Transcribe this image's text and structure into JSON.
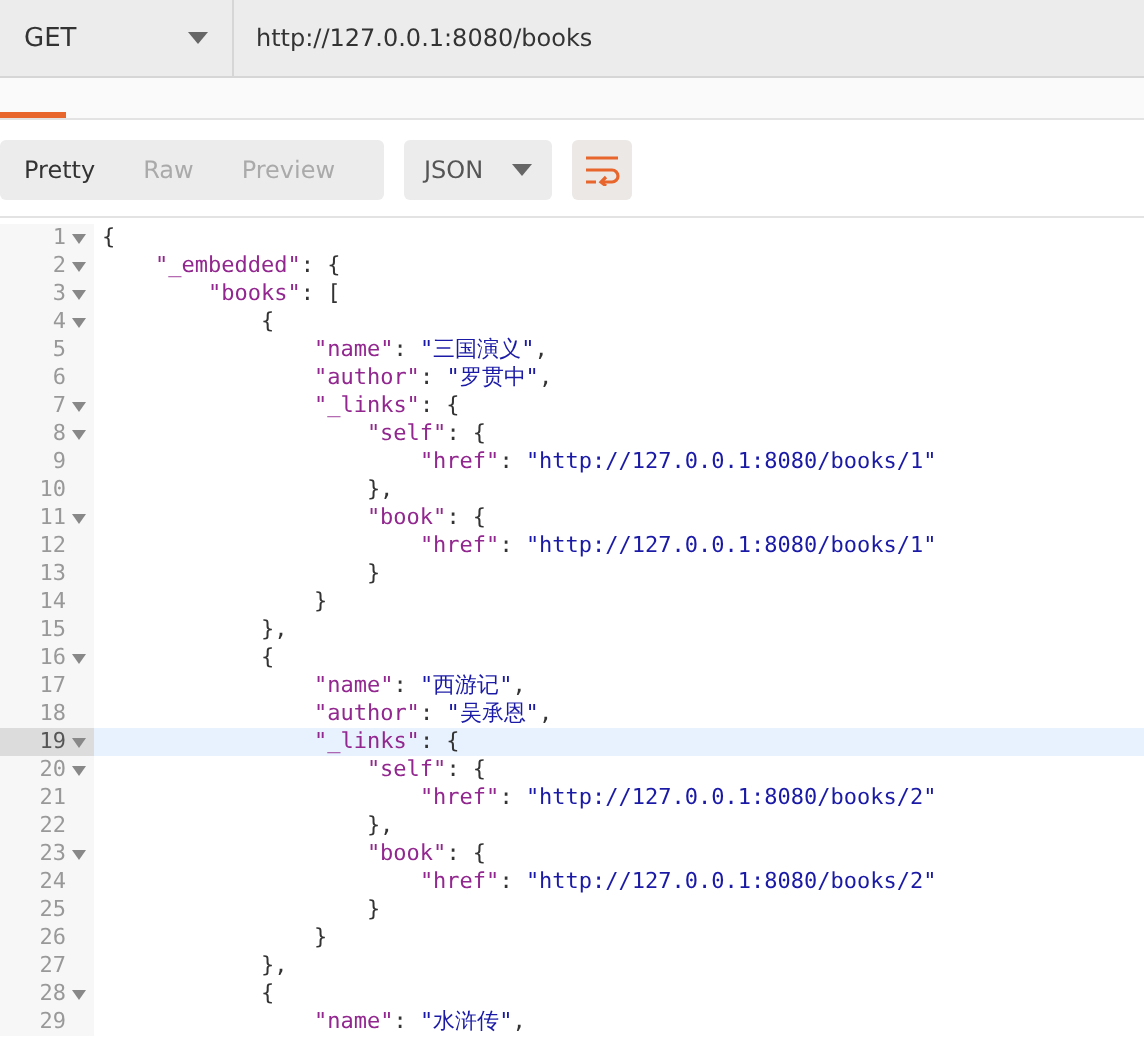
{
  "request": {
    "method": "GET",
    "url": "http://127.0.0.1:8080/books"
  },
  "view_tabs": [
    {
      "label": "Pretty",
      "selected": true
    },
    {
      "label": "Raw",
      "selected": false
    },
    {
      "label": "Preview",
      "selected": false
    }
  ],
  "format": "JSON",
  "wrap_lines": {
    "on": true
  },
  "editor": {
    "lines": [
      {
        "number": "1",
        "fold": true,
        "active": false,
        "parts": [
          {
            "kind": "punct",
            "text": "{"
          }
        ]
      },
      {
        "number": "2",
        "fold": true,
        "active": false,
        "parts": [
          {
            "kind": "key",
            "text": "\"_embedded\""
          },
          {
            "kind": "punct",
            "text": ": {"
          }
        ]
      },
      {
        "number": "3",
        "fold": true,
        "active": false,
        "parts": [
          {
            "kind": "key",
            "text": "\"books\""
          },
          {
            "kind": "punct",
            "text": ": ["
          }
        ]
      },
      {
        "number": "4",
        "fold": true,
        "active": false,
        "parts": [
          {
            "kind": "punct",
            "text": "{"
          }
        ]
      },
      {
        "number": "5",
        "fold": false,
        "active": false,
        "parts": [
          {
            "kind": "key",
            "text": "\"name\""
          },
          {
            "kind": "punct",
            "text": ": "
          },
          {
            "kind": "string",
            "text": "\"三国演义\""
          },
          {
            "kind": "punct",
            "text": ","
          }
        ]
      },
      {
        "number": "6",
        "fold": false,
        "active": false,
        "parts": [
          {
            "kind": "key",
            "text": "\"author\""
          },
          {
            "kind": "punct",
            "text": ": "
          },
          {
            "kind": "string",
            "text": "\"罗贯中\""
          },
          {
            "kind": "punct",
            "text": ","
          }
        ]
      },
      {
        "number": "7",
        "fold": true,
        "active": false,
        "parts": [
          {
            "kind": "key",
            "text": "\"_links\""
          },
          {
            "kind": "punct",
            "text": ": {"
          }
        ]
      },
      {
        "number": "8",
        "fold": true,
        "active": false,
        "parts": [
          {
            "kind": "key",
            "text": "\"self\""
          },
          {
            "kind": "punct",
            "text": ": {"
          }
        ]
      },
      {
        "number": "9",
        "fold": false,
        "active": false,
        "parts": [
          {
            "kind": "key",
            "text": "\"href\""
          },
          {
            "kind": "punct",
            "text": ": "
          },
          {
            "kind": "string",
            "text": "\"http://127.0.0.1:8080/books/1\""
          }
        ]
      },
      {
        "number": "10",
        "fold": false,
        "active": false,
        "parts": [
          {
            "kind": "punct",
            "text": "},"
          }
        ]
      },
      {
        "number": "11",
        "fold": true,
        "active": false,
        "parts": [
          {
            "kind": "key",
            "text": "\"book\""
          },
          {
            "kind": "punct",
            "text": ": {"
          }
        ]
      },
      {
        "number": "12",
        "fold": false,
        "active": false,
        "parts": [
          {
            "kind": "key",
            "text": "\"href\""
          },
          {
            "kind": "punct",
            "text": ": "
          },
          {
            "kind": "string",
            "text": "\"http://127.0.0.1:8080/books/1\""
          }
        ]
      },
      {
        "number": "13",
        "fold": false,
        "active": false,
        "parts": [
          {
            "kind": "punct",
            "text": "}"
          }
        ]
      },
      {
        "number": "14",
        "fold": false,
        "active": false,
        "parts": [
          {
            "kind": "punct",
            "text": "}"
          }
        ]
      },
      {
        "number": "15",
        "fold": false,
        "active": false,
        "parts": [
          {
            "kind": "punct",
            "text": "},"
          }
        ]
      },
      {
        "number": "16",
        "fold": true,
        "active": false,
        "parts": [
          {
            "kind": "punct",
            "text": "{"
          }
        ]
      },
      {
        "number": "17",
        "fold": false,
        "active": false,
        "parts": [
          {
            "kind": "key",
            "text": "\"name\""
          },
          {
            "kind": "punct",
            "text": ": "
          },
          {
            "kind": "string",
            "text": "\"西游记\""
          },
          {
            "kind": "punct",
            "text": ","
          }
        ]
      },
      {
        "number": "18",
        "fold": false,
        "active": false,
        "parts": [
          {
            "kind": "key",
            "text": "\"author\""
          },
          {
            "kind": "punct",
            "text": ": "
          },
          {
            "kind": "string",
            "text": "\"吴承恩\""
          },
          {
            "kind": "punct",
            "text": ","
          }
        ]
      },
      {
        "number": "19",
        "fold": true,
        "active": true,
        "parts": [
          {
            "kind": "key",
            "text": "\"_links\""
          },
          {
            "kind": "punct",
            "text": ": {"
          }
        ]
      },
      {
        "number": "20",
        "fold": true,
        "active": false,
        "parts": [
          {
            "kind": "key",
            "text": "\"self\""
          },
          {
            "kind": "punct",
            "text": ": {"
          }
        ]
      },
      {
        "number": "21",
        "fold": false,
        "active": false,
        "parts": [
          {
            "kind": "key",
            "text": "\"href\""
          },
          {
            "kind": "punct",
            "text": ": "
          },
          {
            "kind": "string",
            "text": "\"http://127.0.0.1:8080/books/2\""
          }
        ]
      },
      {
        "number": "22",
        "fold": false,
        "active": false,
        "parts": [
          {
            "kind": "punct",
            "text": "},"
          }
        ]
      },
      {
        "number": "23",
        "fold": true,
        "active": false,
        "parts": [
          {
            "kind": "key",
            "text": "\"book\""
          },
          {
            "kind": "punct",
            "text": ": {"
          }
        ]
      },
      {
        "number": "24",
        "fold": false,
        "active": false,
        "parts": [
          {
            "kind": "key",
            "text": "\"href\""
          },
          {
            "kind": "punct",
            "text": ": "
          },
          {
            "kind": "string",
            "text": "\"http://127.0.0.1:8080/books/2\""
          }
        ]
      },
      {
        "number": "25",
        "fold": false,
        "active": false,
        "parts": [
          {
            "kind": "punct",
            "text": "}"
          }
        ]
      },
      {
        "number": "26",
        "fold": false,
        "active": false,
        "parts": [
          {
            "kind": "punct",
            "text": "}"
          }
        ]
      },
      {
        "number": "27",
        "fold": false,
        "active": false,
        "parts": [
          {
            "kind": "punct",
            "text": "},"
          }
        ]
      },
      {
        "number": "28",
        "fold": true,
        "active": false,
        "parts": [
          {
            "kind": "punct",
            "text": "{"
          }
        ]
      },
      {
        "number": "29",
        "fold": false,
        "active": false,
        "parts": [
          {
            "kind": "key",
            "text": "\"name\""
          },
          {
            "kind": "punct",
            "text": ": "
          },
          {
            "kind": "string",
            "text": "\"水浒传\""
          },
          {
            "kind": "punct",
            "text": ","
          }
        ]
      }
    ]
  }
}
